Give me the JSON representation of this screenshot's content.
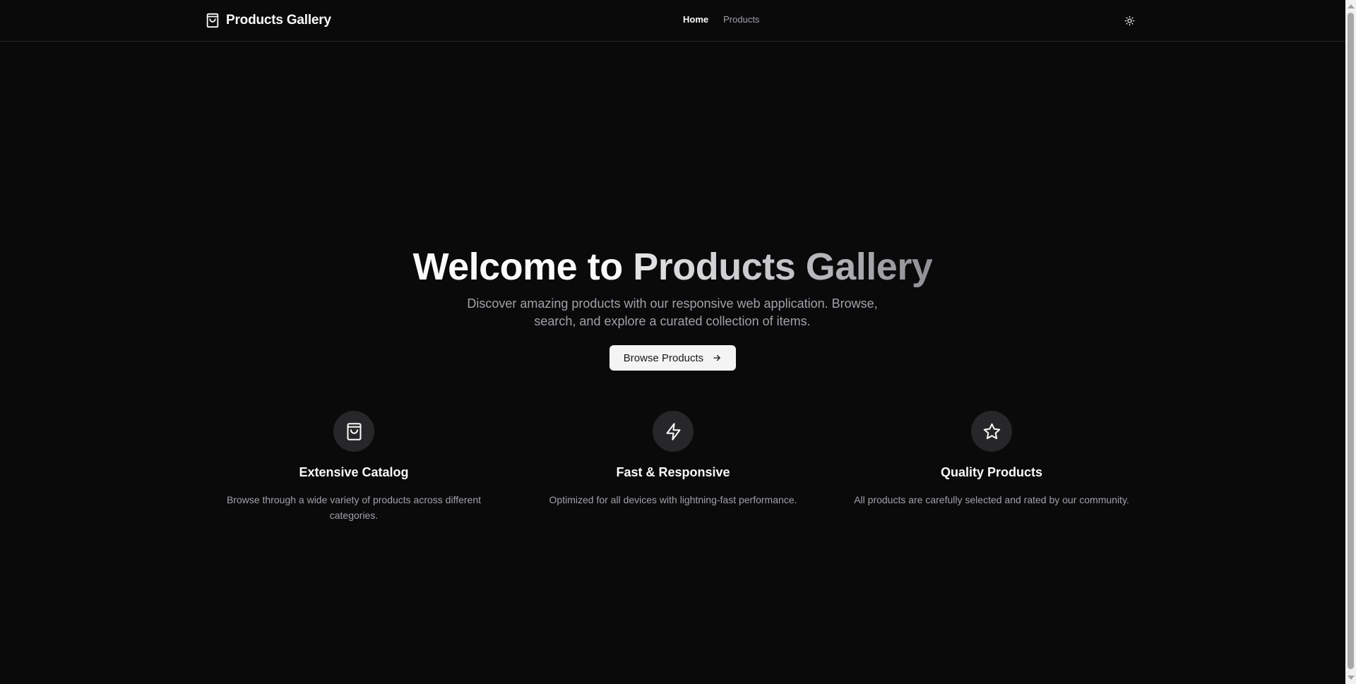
{
  "header": {
    "brand_title": "Products Gallery",
    "brand_icon": "shopping-bag-icon",
    "nav": [
      {
        "label": "Home",
        "active": true
      },
      {
        "label": "Products",
        "active": false
      }
    ],
    "theme_toggle_icon": "sun-icon"
  },
  "hero": {
    "title_plain": "Welcome to",
    "title_gradient": "Products Gallery",
    "subtitle": "Discover amazing products with our responsive web application. Browse, search, and explore a curated collection of items.",
    "cta_label": "Browse Products",
    "cta_icon": "arrow-right-icon"
  },
  "features": [
    {
      "icon": "shopping-bag-icon",
      "title": "Extensive Catalog",
      "description": "Browse through a wide variety of products across different categories."
    },
    {
      "icon": "lightning-icon",
      "title": "Fast & Responsive",
      "description": "Optimized for all devices with lightning-fast performance."
    },
    {
      "icon": "star-icon",
      "title": "Quality Products",
      "description": "All products are carefully selected and rated by our community."
    }
  ],
  "colors": {
    "background": "#0a0a0a",
    "text": "#fafafa",
    "muted_text": "#a1a1aa",
    "border": "#27272a",
    "icon_circle": "#27272a",
    "cta_background": "#f4f4f5"
  }
}
